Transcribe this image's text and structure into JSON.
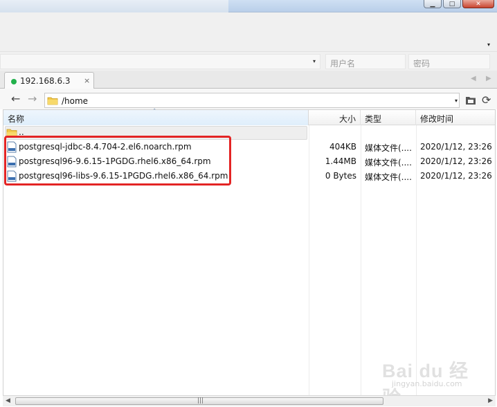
{
  "window": {
    "min_glyph": "▁",
    "max_glyph": "□",
    "close_glyph": "✕"
  },
  "connection": {
    "user_placeholder": "用户名",
    "password_placeholder": "密码"
  },
  "tab": {
    "label": "192.168.6.3",
    "close": "×",
    "status_color": "#22b14c"
  },
  "path": {
    "value": "/home"
  },
  "columns": {
    "name": "名称",
    "size": "大小",
    "type": "类型",
    "mtime": "修改时间"
  },
  "parent_row": {
    "name": ".."
  },
  "files": [
    {
      "name": "postgresql-jdbc-8.4.704-2.el6.noarch.rpm",
      "size": "404KB",
      "type": "媒体文件(....",
      "mtime": "2020/1/12, 23:26"
    },
    {
      "name": "postgresql96-9.6.15-1PGDG.rhel6.x86_64.rpm",
      "size": "1.44MB",
      "type": "媒体文件(....",
      "mtime": "2020/1/12, 23:26"
    },
    {
      "name": "postgresql96-libs-9.6.15-1PGDG.rhel6.x86_64.rpm",
      "size": "0 Bytes",
      "type": "媒体文件(....",
      "mtime": "2020/1/12, 23:26"
    }
  ],
  "highlight_color": "#e32424",
  "watermark": {
    "main": "Bai du 经验",
    "sub": "jingyan.baidu.com"
  },
  "icons": {
    "back": "←",
    "forward": "→",
    "refresh": "⟳",
    "dropdown": "▾",
    "tab_prev": "◀",
    "tab_next": "▶",
    "sort_asc": "ˆ",
    "scroll_left": "◀",
    "scroll_right": "▶",
    "grip": "|||"
  }
}
